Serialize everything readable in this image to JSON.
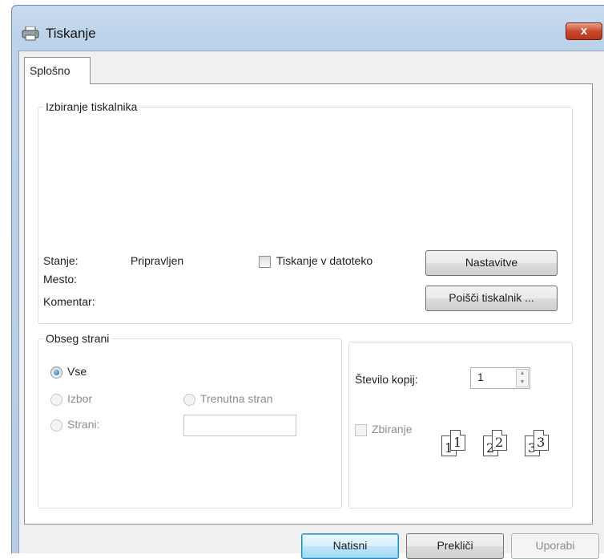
{
  "window": {
    "title": "Tiskanje",
    "close_glyph": "x"
  },
  "tabs": [
    {
      "label": "Splošno",
      "active": true
    }
  ],
  "printer_group": {
    "legend": "Izbiranje tiskalnika",
    "status_label": "Stanje:",
    "status_value": "Pripravljen",
    "location_label": "Mesto:",
    "comment_label": "Komentar:",
    "print_to_file_label": "Tiskanje v datoteko",
    "print_to_file_checked": false,
    "preferences_button": "Nastavitve",
    "find_printer_button": "Poišči tiskalnik ..."
  },
  "page_range": {
    "legend": "Obseg strani",
    "all_label": "Vse",
    "all_checked": true,
    "selection_label": "Izbor",
    "current_page_label": "Trenutna stran",
    "pages_label": "Strani:",
    "pages_value": ""
  },
  "copies": {
    "count_label": "Število kopij:",
    "count_value": "1",
    "collate_label": "Zbiranje",
    "collate_checked": false,
    "collate_pages": [
      "1",
      "1",
      "2",
      "2",
      "3",
      "3"
    ]
  },
  "footer": {
    "print_button": "Natisni",
    "cancel_button": "Prekliči",
    "apply_button": "Uporabi"
  },
  "icons": {
    "title": "printer-icon"
  }
}
